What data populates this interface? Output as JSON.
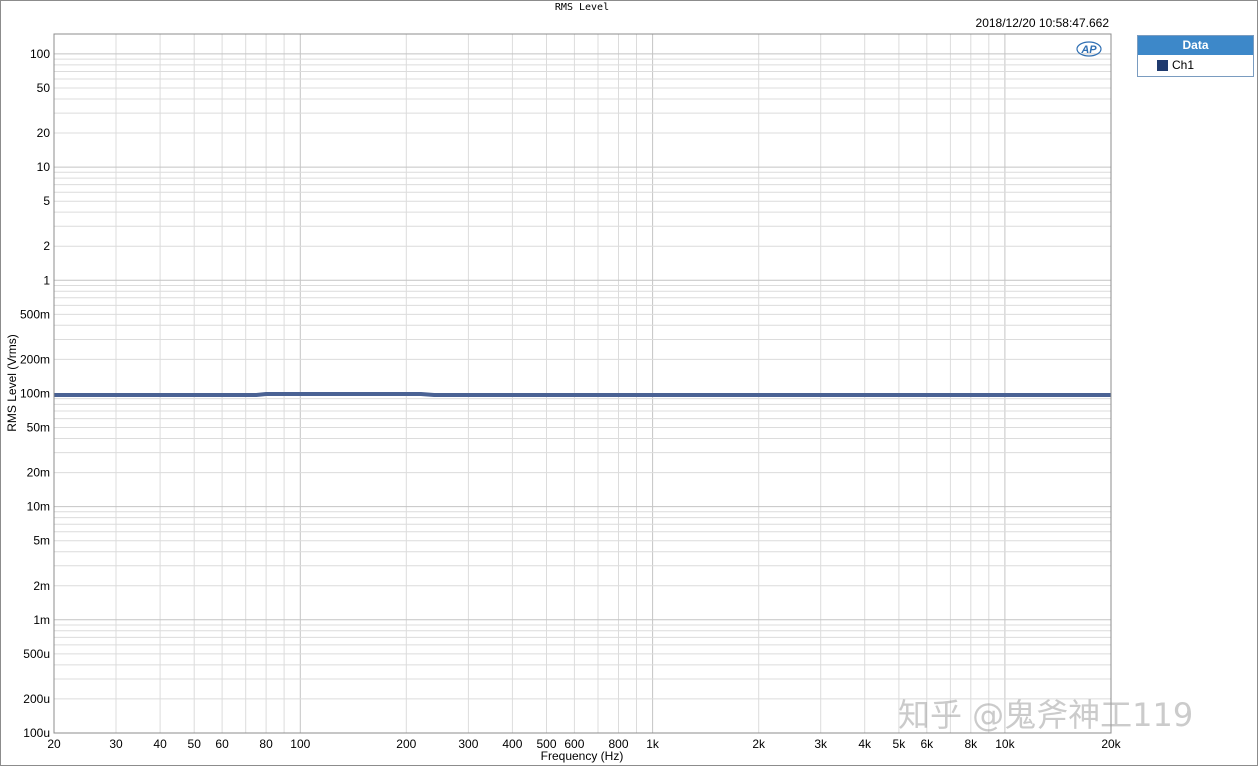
{
  "header": {
    "timestamp": "2018/12/20 10:58:47.662",
    "logo_text": "AP"
  },
  "legend": {
    "header": "Data",
    "entries": [
      {
        "name": "Ch1",
        "color": "#1f3a6e"
      }
    ]
  },
  "watermark": "知乎 @鬼斧神工119",
  "chart_data": {
    "type": "line",
    "title": "RMS Level",
    "xlabel": "Frequency (Hz)",
    "ylabel": "RMS Level (Vrms)",
    "x_scale": "log",
    "y_scale": "log",
    "xlim": [
      20,
      20000
    ],
    "ylim": [
      0.0001,
      150
    ],
    "grid": true,
    "legend_position": "right",
    "x_ticks": [
      {
        "value": 20,
        "label": "20"
      },
      {
        "value": 30,
        "label": "30"
      },
      {
        "value": 40,
        "label": "40"
      },
      {
        "value": 50,
        "label": "50"
      },
      {
        "value": 60,
        "label": "60"
      },
      {
        "value": 80,
        "label": "80"
      },
      {
        "value": 100,
        "label": "100"
      },
      {
        "value": 200,
        "label": "200"
      },
      {
        "value": 300,
        "label": "300"
      },
      {
        "value": 400,
        "label": "400"
      },
      {
        "value": 500,
        "label": "500"
      },
      {
        "value": 600,
        "label": "600"
      },
      {
        "value": 800,
        "label": "800"
      },
      {
        "value": 1000,
        "label": "1k"
      },
      {
        "value": 2000,
        "label": "2k"
      },
      {
        "value": 3000,
        "label": "3k"
      },
      {
        "value": 4000,
        "label": "4k"
      },
      {
        "value": 5000,
        "label": "5k"
      },
      {
        "value": 6000,
        "label": "6k"
      },
      {
        "value": 8000,
        "label": "8k"
      },
      {
        "value": 10000,
        "label": "10k"
      },
      {
        "value": 20000,
        "label": "20k"
      }
    ],
    "y_ticks": [
      {
        "value": 100,
        "label": "100"
      },
      {
        "value": 50,
        "label": "50"
      },
      {
        "value": 20,
        "label": "20"
      },
      {
        "value": 10,
        "label": "10"
      },
      {
        "value": 5,
        "label": "5"
      },
      {
        "value": 2,
        "label": "2"
      },
      {
        "value": 1,
        "label": "1"
      },
      {
        "value": 0.5,
        "label": "500m"
      },
      {
        "value": 0.2,
        "label": "200m"
      },
      {
        "value": 0.1,
        "label": "100m"
      },
      {
        "value": 0.05,
        "label": "50m"
      },
      {
        "value": 0.02,
        "label": "20m"
      },
      {
        "value": 0.01,
        "label": "10m"
      },
      {
        "value": 0.005,
        "label": "5m"
      },
      {
        "value": 0.002,
        "label": "2m"
      },
      {
        "value": 0.001,
        "label": "1m"
      },
      {
        "value": 0.0005,
        "label": "500u"
      },
      {
        "value": 0.0002,
        "label": "200u"
      },
      {
        "value": 0.0001,
        "label": "100u"
      }
    ],
    "series": [
      {
        "name": "Ch1",
        "color": "#4a6294",
        "x": [
          20,
          50,
          75,
          80,
          100,
          150,
          200,
          220,
          240,
          300,
          500,
          1000,
          2000,
          5000,
          10000,
          20000
        ],
        "y": [
          0.097,
          0.097,
          0.097,
          0.099,
          0.099,
          0.099,
          0.099,
          0.099,
          0.097,
          0.097,
          0.097,
          0.097,
          0.097,
          0.097,
          0.097,
          0.097
        ]
      }
    ]
  }
}
